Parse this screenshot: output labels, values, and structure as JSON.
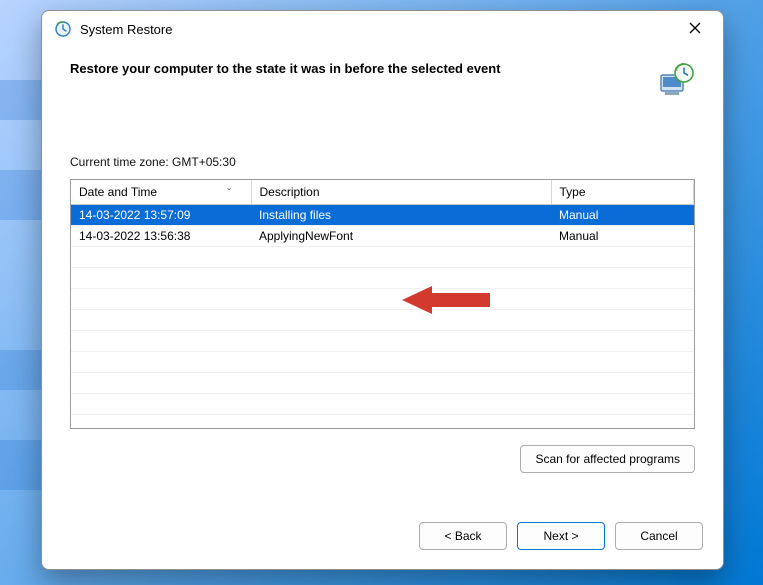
{
  "window": {
    "title": "System Restore"
  },
  "heading": "Restore your computer to the state it was in before the selected event",
  "timezone_label": "Current time zone: GMT+05:30",
  "columns": {
    "datetime": "Date and Time",
    "description": "Description",
    "type": "Type"
  },
  "restore_points": [
    {
      "datetime": "14-03-2022 13:57:09",
      "description": "Installing files",
      "type": "Manual",
      "selected": true
    },
    {
      "datetime": "14-03-2022 13:56:38",
      "description": "ApplyingNewFont",
      "type": "Manual",
      "selected": false
    }
  ],
  "buttons": {
    "scan": "Scan for affected programs",
    "back": "< Back",
    "next": "Next >",
    "cancel": "Cancel"
  }
}
